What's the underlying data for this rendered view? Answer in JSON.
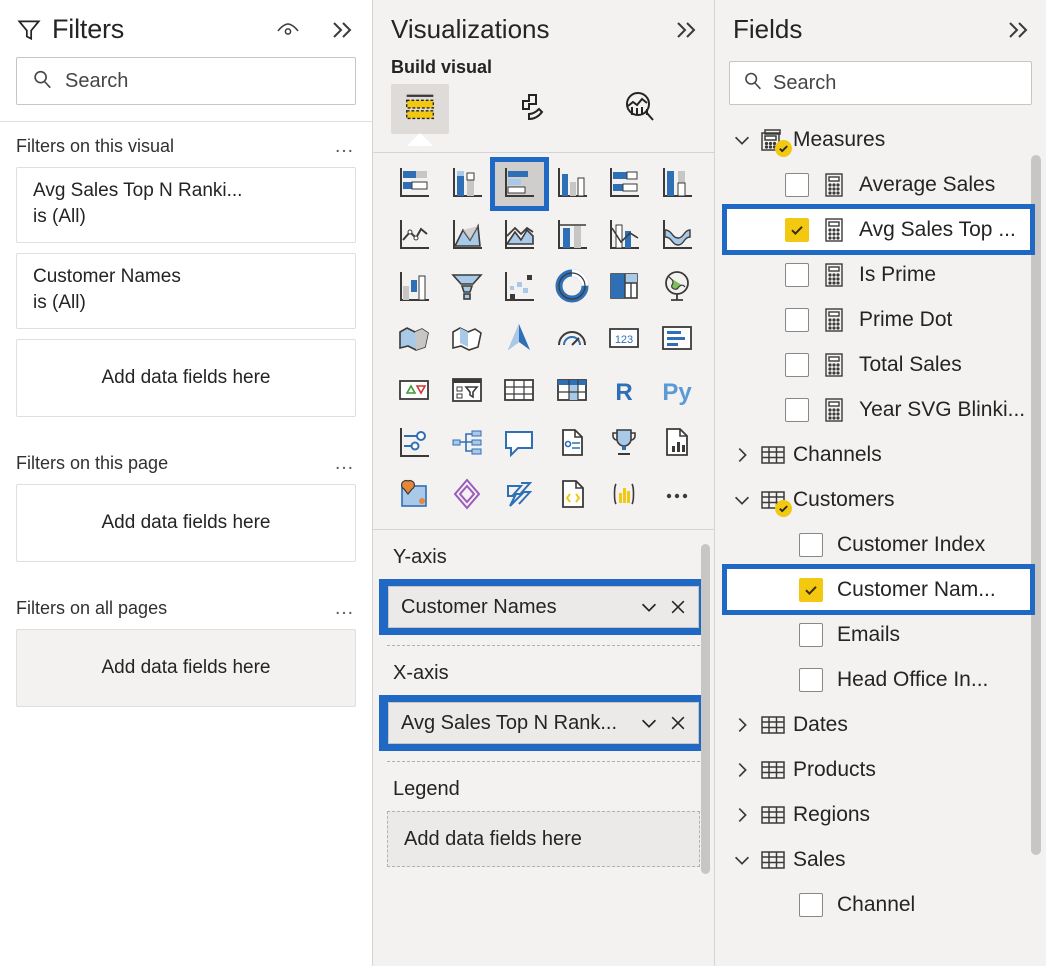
{
  "filters": {
    "title": "Filters",
    "eye_icon": "eye-icon",
    "collapse_icon": "double-chevron-right-icon",
    "search": {
      "placeholder": "Search",
      "value": "",
      "icon": "search-icon"
    },
    "sections": [
      {
        "title": "Filters on this visual",
        "menu": "…",
        "cards": [
          {
            "field": "Avg Sales Top N Ranki...",
            "condition": "is (All)"
          },
          {
            "field": "Customer Names",
            "condition": "is (All)"
          }
        ],
        "dropzone": "Add data fields here",
        "dropzone_shaded": false
      },
      {
        "title": "Filters on this page",
        "menu": "…",
        "cards": [],
        "dropzone": "Add data fields here",
        "dropzone_shaded": false
      },
      {
        "title": "Filters on all pages",
        "menu": "…",
        "cards": [],
        "dropzone": "Add data fields here",
        "dropzone_shaded": true
      }
    ]
  },
  "visualizations": {
    "title": "Visualizations",
    "collapse_icon": "double-chevron-right-icon",
    "build_label": "Build visual",
    "tabs": [
      {
        "name": "build-visual-tab",
        "icon": "fields-table-icon",
        "active": true
      },
      {
        "name": "format-visual-tab",
        "icon": "paint-roller-icon",
        "active": false
      },
      {
        "name": "analytics-tab",
        "icon": "magnifier-chart-icon",
        "active": false
      }
    ],
    "gallery": [
      {
        "name": "stacked-bar-chart",
        "selected": false
      },
      {
        "name": "stacked-column-chart",
        "selected": false
      },
      {
        "name": "clustered-bar-chart",
        "selected": true
      },
      {
        "name": "clustered-column-chart",
        "selected": false
      },
      {
        "name": "100-percent-stacked-bar-chart",
        "selected": false
      },
      {
        "name": "100-percent-stacked-column-chart",
        "selected": false
      },
      {
        "name": "line-chart",
        "selected": false
      },
      {
        "name": "area-chart",
        "selected": false
      },
      {
        "name": "stacked-area-chart",
        "selected": false
      },
      {
        "name": "line-and-stacked-column-chart",
        "selected": false
      },
      {
        "name": "line-and-clustered-column-chart",
        "selected": false
      },
      {
        "name": "ribbon-chart",
        "selected": false
      },
      {
        "name": "waterfall-chart",
        "selected": false
      },
      {
        "name": "funnel-chart",
        "selected": false
      },
      {
        "name": "scatter-chart",
        "selected": false
      },
      {
        "name": "pie-chart",
        "selected": false
      },
      {
        "name": "treemap",
        "selected": false
      },
      {
        "name": "map",
        "selected": false
      },
      {
        "name": "filled-map",
        "selected": false
      },
      {
        "name": "shape-map",
        "selected": false
      },
      {
        "name": "azure-map",
        "selected": false
      },
      {
        "name": "gauge-chart",
        "selected": false
      },
      {
        "name": "card-visual",
        "selected": false
      },
      {
        "name": "multi-row-card",
        "selected": false
      },
      {
        "name": "kpi-visual",
        "selected": false
      },
      {
        "name": "slicer-visual",
        "selected": false
      },
      {
        "name": "table-visual",
        "selected": false
      },
      {
        "name": "matrix-visual",
        "selected": false
      },
      {
        "name": "r-script-visual",
        "selected": false
      },
      {
        "name": "python-script-visual",
        "selected": false
      },
      {
        "name": "key-influencers",
        "selected": false
      },
      {
        "name": "decomposition-tree",
        "selected": false
      },
      {
        "name": "qna-visual",
        "selected": false
      },
      {
        "name": "smart-narrative",
        "selected": false
      },
      {
        "name": "metrics-visual",
        "selected": false
      },
      {
        "name": "paginated-report",
        "selected": false
      },
      {
        "name": "arcgis-map",
        "selected": false
      },
      {
        "name": "power-apps-visual",
        "selected": false
      },
      {
        "name": "power-automate-visual",
        "selected": false
      },
      {
        "name": "developer-visual",
        "selected": false
      },
      {
        "name": "get-more-visuals",
        "selected": false
      },
      {
        "name": "more-options-ellipsis",
        "selected": false
      }
    ],
    "wells": [
      {
        "label": "Y-axis",
        "highlighted": true,
        "chip": {
          "text": "Customer Names",
          "dropdown_icon": "chevron-down-icon",
          "remove_icon": "close-x-icon"
        }
      },
      {
        "label": "X-axis",
        "highlighted": true,
        "chip": {
          "text": "Avg Sales Top N Rank...",
          "dropdown_icon": "chevron-down-icon",
          "remove_icon": "close-x-icon"
        }
      },
      {
        "label": "Legend",
        "highlighted": false,
        "dropzone": "Add data fields here"
      }
    ]
  },
  "fields": {
    "title": "Fields",
    "collapse_icon": "double-chevron-right-icon",
    "search": {
      "placeholder": "Search",
      "value": "",
      "icon": "search-icon"
    },
    "tree": [
      {
        "type": "table",
        "label": "Measures",
        "expanded": true,
        "icon": "measures-table-icon",
        "has_check_badge": true,
        "children": [
          {
            "label": "Average Sales",
            "checked": false,
            "icon": "measure-icon",
            "highlighted": false
          },
          {
            "label": "Avg Sales Top ...",
            "checked": true,
            "icon": "measure-icon",
            "highlighted": true
          },
          {
            "label": "Is Prime",
            "checked": false,
            "icon": "measure-icon",
            "highlighted": false
          },
          {
            "label": "Prime Dot",
            "checked": false,
            "icon": "measure-icon",
            "highlighted": false
          },
          {
            "label": "Total Sales",
            "checked": false,
            "icon": "measure-icon",
            "highlighted": false
          },
          {
            "label": "Year SVG Blinki...",
            "checked": false,
            "icon": "measure-icon",
            "highlighted": false
          }
        ]
      },
      {
        "type": "table",
        "label": "Channels",
        "expanded": false,
        "icon": "table-icon",
        "has_check_badge": false,
        "children": []
      },
      {
        "type": "table",
        "label": "Customers",
        "expanded": true,
        "icon": "table-icon",
        "has_check_badge": true,
        "children": [
          {
            "label": "Customer Index",
            "checked": false,
            "icon": null,
            "highlighted": false
          },
          {
            "label": "Customer Nam...",
            "checked": true,
            "icon": null,
            "highlighted": true
          },
          {
            "label": "Emails",
            "checked": false,
            "icon": null,
            "highlighted": false
          },
          {
            "label": "Head Office In...",
            "checked": false,
            "icon": null,
            "highlighted": false
          }
        ]
      },
      {
        "type": "table",
        "label": "Dates",
        "expanded": false,
        "icon": "table-icon",
        "has_check_badge": false,
        "children": []
      },
      {
        "type": "table",
        "label": "Products",
        "expanded": false,
        "icon": "table-icon",
        "has_check_badge": false,
        "children": []
      },
      {
        "type": "table",
        "label": "Regions",
        "expanded": false,
        "icon": "table-icon",
        "has_check_badge": false,
        "children": []
      },
      {
        "type": "table",
        "label": "Sales",
        "expanded": true,
        "icon": "table-icon",
        "has_check_badge": false,
        "children": [
          {
            "label": "Channel",
            "checked": false,
            "icon": null,
            "highlighted": false
          }
        ]
      }
    ]
  },
  "colors": {
    "selection_blue": "#1f68c4",
    "check_yellow": "#f2c811",
    "panel_gray": "#f3f2f1",
    "text": "#252423",
    "border": "#c8c6c4"
  }
}
